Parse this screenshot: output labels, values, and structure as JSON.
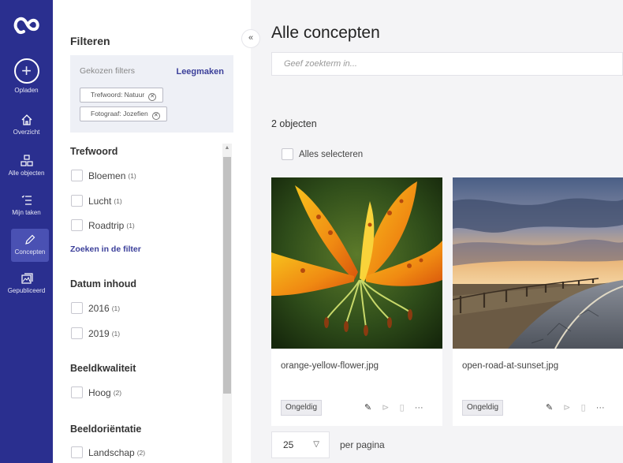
{
  "rail": {
    "items": [
      {
        "label": "Opladen",
        "icon": "plus-icon"
      },
      {
        "label": "Overzicht",
        "icon": "home-icon"
      },
      {
        "label": "Alle objecten",
        "icon": "objects-icon"
      },
      {
        "label": "Mijn taken",
        "icon": "tasks-icon"
      },
      {
        "label": "Concepten",
        "icon": "pencil-icon"
      },
      {
        "label": "Gepubliceerd",
        "icon": "published-icon"
      }
    ],
    "active": "Concepten",
    "bg_color": "#2a2f8f"
  },
  "filters": {
    "title": "Filteren",
    "chosen_label": "Gekozen filters",
    "clear_label": "Leegmaken",
    "chips": [
      "Trefwoord: Natuur",
      "Fotograaf: Jozefien"
    ],
    "sections": [
      {
        "title": "Trefwoord",
        "options": [
          {
            "label": "Bloemen",
            "count": "(1)"
          },
          {
            "label": "Lucht",
            "count": "(1)"
          },
          {
            "label": "Roadtrip",
            "count": "(1)"
          }
        ]
      },
      {
        "title": "Datum inhoud",
        "options": [
          {
            "label": "2016",
            "count": "(1)"
          },
          {
            "label": "2019",
            "count": "(1)"
          }
        ]
      },
      {
        "title": "Beeldkwaliteit",
        "options": [
          {
            "label": "Hoog",
            "count": "(2)"
          }
        ]
      },
      {
        "title": "Beeldoriëntatie",
        "options": [
          {
            "label": "Landschap",
            "count": "(2)"
          }
        ]
      }
    ],
    "search_in_filter": "Zoeken in de filter"
  },
  "main": {
    "title": "Alle concepten",
    "search_placeholder": "Geef zoekterm in...",
    "count_text": "2 objecten",
    "select_all": "Alles selecteren",
    "cards": [
      {
        "filename": "orange-yellow-flower.jpg",
        "status": "Ongeldig"
      },
      {
        "filename": "open-road-at-sunset.jpg",
        "status": "Ongeldig"
      }
    ],
    "per_page_value": "25",
    "per_page_label": "per pagina"
  },
  "colors": {
    "accent": "#3b3f9a",
    "rail": "#2a2f8f"
  }
}
